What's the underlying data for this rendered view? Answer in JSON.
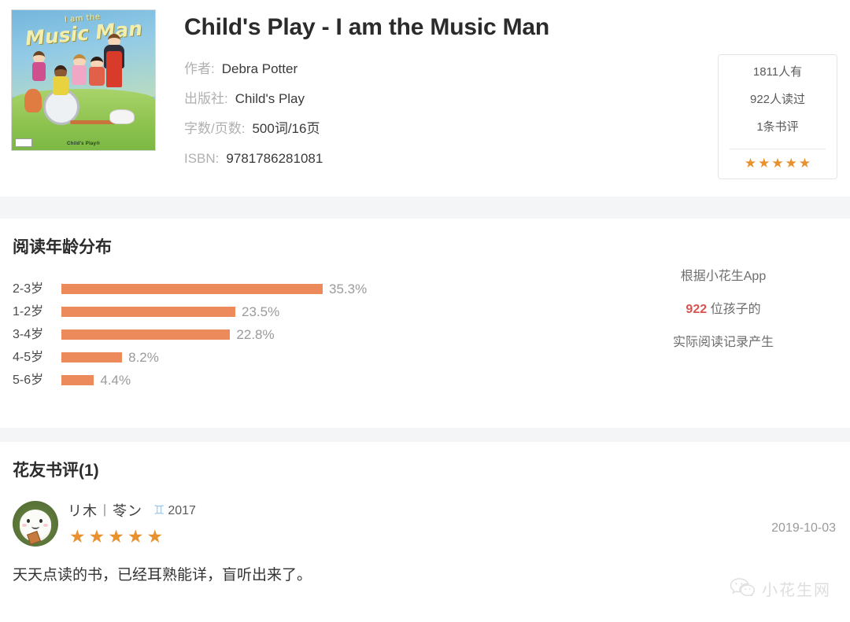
{
  "book": {
    "title": "Child's Play - I am the Music Man",
    "cover": {
      "title_small": "I am the",
      "title_big": "Music Man",
      "imprint": "Child's Play®",
      "alt": "book-cover-illustration"
    },
    "meta": [
      {
        "label": "作者:",
        "value": "Debra Potter"
      },
      {
        "label": "出版社:",
        "value": "Child's Play"
      },
      {
        "label": "字数/页数:",
        "value": "500词/16页"
      },
      {
        "label": "ISBN:",
        "value": "9781786281081"
      }
    ]
  },
  "stats": {
    "have": "1811人有",
    "read": "922人读过",
    "reviews": "1条书评",
    "rating": 5,
    "star_glyph": "★",
    "star_color": "#e8912f"
  },
  "chart_section": {
    "title": "阅读年龄分布",
    "note_line1": "根据小花生App",
    "note_number": "922",
    "note_line2_suffix": " 位孩子的",
    "note_line3": "实际阅读记录产生"
  },
  "chart_data": {
    "type": "bar",
    "orientation": "horizontal",
    "title": "阅读年龄分布",
    "xlabel": "",
    "ylabel": "",
    "grid": false,
    "legend": "none",
    "bar_color": "#ec8a5c",
    "categories": [
      "2-3岁",
      "1-2岁",
      "3-4岁",
      "4-5岁",
      "5-6岁"
    ],
    "values": [
      35.3,
      23.5,
      22.8,
      8.2,
      4.4
    ],
    "value_labels": [
      "35.3%",
      "23.5%",
      "22.8%",
      "8.2%",
      "4.4%"
    ],
    "xlim": [
      0,
      35.3
    ],
    "unit": "%"
  },
  "reviews": {
    "title": "花友书评(1)",
    "items": [
      {
        "avatar_name": "user-avatar",
        "username": "リ木︱苓ン",
        "zodiac": "♊",
        "zodiac_year": "2017",
        "rating": 5,
        "date": "2019-10-03",
        "text": "天天点读的书，已经耳熟能详，盲听出来了。"
      }
    ]
  },
  "watermark": {
    "text": "小花生网"
  }
}
